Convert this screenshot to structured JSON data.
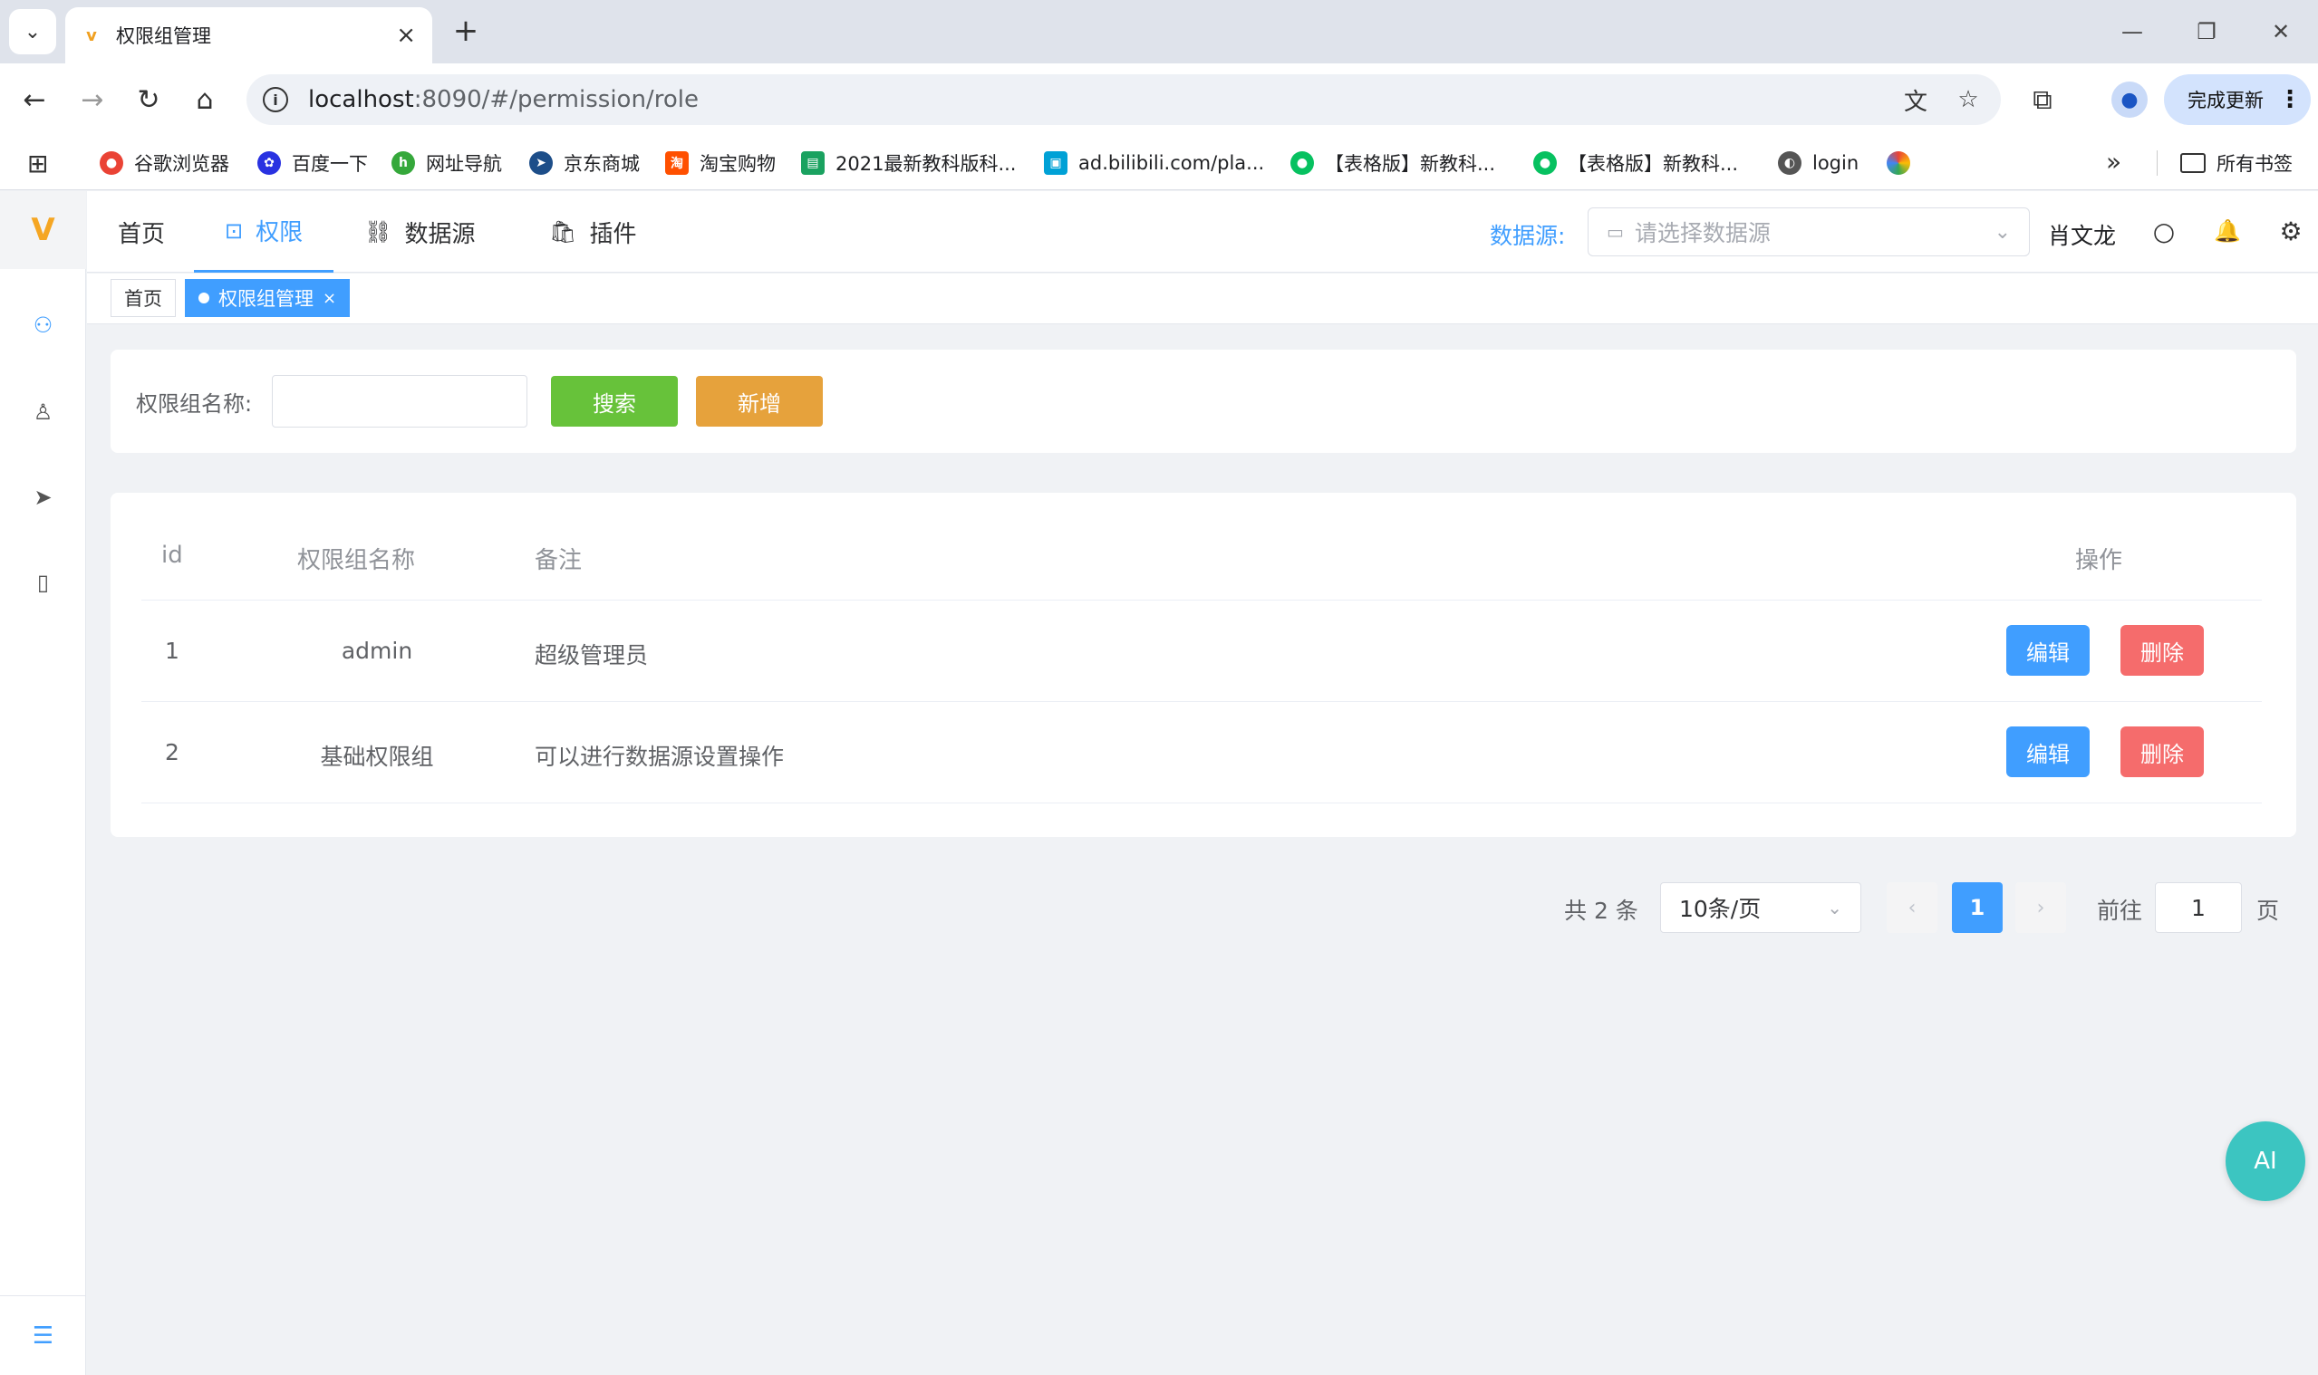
{
  "browser": {
    "tab_title": "权限组管理",
    "url_host": "localhost",
    "url_rest": ":8090/#/permission/role",
    "update_label": "完成更新",
    "bookmarks": [
      {
        "label": "谷歌浏览器",
        "color": "#ea4335"
      },
      {
        "label": "百度一下",
        "color": "#2932e1"
      },
      {
        "label": "网址导航",
        "color": "#35a83b"
      },
      {
        "label": "京东商城",
        "color": "#1d4e89"
      },
      {
        "label": "淘宝购物",
        "color": "#ff5000"
      },
      {
        "label": "2021最新教科版科...",
        "color": "#1aa260"
      },
      {
        "label": "ad.bilibili.com/pla...",
        "color": "#00a1d6"
      },
      {
        "label": "【表格版】新教科...",
        "color": "#07c160"
      },
      {
        "label": "【表格版】新教科...",
        "color": "#07c160"
      },
      {
        "label": "login",
        "color": "#555555"
      }
    ],
    "all_bookmarks": "所有书签"
  },
  "topnav": {
    "items": [
      {
        "label": "首页"
      },
      {
        "label": "权限"
      },
      {
        "label": "数据源"
      },
      {
        "label": "插件"
      }
    ],
    "datasource_label": "数据源:",
    "datasource_placeholder": "请选择数据源",
    "user_name": "肖文龙"
  },
  "tags": {
    "home": "首页",
    "current": "权限组管理"
  },
  "search": {
    "label": "权限组名称:",
    "value": "",
    "search_button": "搜索",
    "add_button": "新增"
  },
  "table": {
    "headers": [
      "id",
      "权限组名称",
      "备注",
      "操作"
    ],
    "rows": [
      {
        "id": "1",
        "name": "admin",
        "remark": "超级管理员"
      },
      {
        "id": "2",
        "name": "基础权限组",
        "remark": "可以进行数据源设置操作"
      }
    ],
    "edit_label": "编辑",
    "delete_label": "删除"
  },
  "pagination": {
    "total": "共 2 条",
    "page_size": "10条/页",
    "current_page": "1",
    "goto_label": "前往",
    "goto_value": "1",
    "page_suffix": "页"
  },
  "ai_button": "AI",
  "colors": {
    "primary": "#409eff",
    "success": "#67c23a",
    "warning": "#e6a23c",
    "danger": "#f56c6c",
    "ai": "#3cc5c1"
  }
}
